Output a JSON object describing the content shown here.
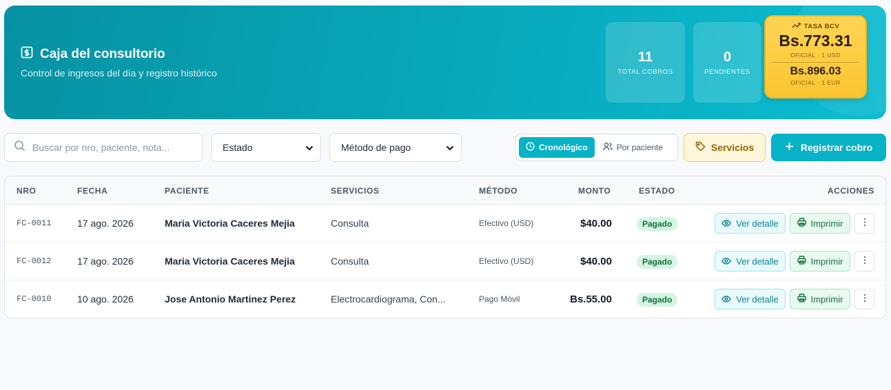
{
  "header": {
    "title": "Caja del consultorio",
    "subtitle": "Control de ingresos del día y registro histórico",
    "stats": [
      {
        "value": "11",
        "label": "TOTAL COBROS"
      },
      {
        "value": "0",
        "label": "PENDIENTES"
      }
    ],
    "rate": {
      "label": "TASA BCV",
      "usd_value": "Bs.773.31",
      "usd_note": "OFICIAL · 1 USD",
      "eur_value": "Bs.896.03",
      "eur_note": "OFICIAL · 1 EUR"
    }
  },
  "toolbar": {
    "search_placeholder": "Buscar por nro, paciente, nota...",
    "estado_select": "Estado",
    "metodo_select": "Método de pago",
    "view_chrono": "Cronológico",
    "view_patient": "Por paciente",
    "services_button": "Servicios",
    "register_button": "Registrar cobro"
  },
  "table": {
    "headers": {
      "nro": "NRO",
      "fecha": "FECHA",
      "paciente": "PACIENTE",
      "servicios": "SERVICIOS",
      "metodo": "MÉTODO",
      "monto": "MONTO",
      "estado": "ESTADO",
      "acciones": "ACCIONES"
    },
    "actions": {
      "view": "Ver detalle",
      "print": "Imprimir"
    },
    "rows": [
      {
        "nro": "FC-0011",
        "fecha": "17 ago. 2026",
        "paciente": "Maria Victoria Caceres Mejia",
        "servicios": "Consulta",
        "metodo": "Efectivo (USD)",
        "monto": "$40.00",
        "estado": "Pagado"
      },
      {
        "nro": "FC-0012",
        "fecha": "17 ago. 2026",
        "paciente": "Maria Victoria Caceres Mejia",
        "servicios": "Consulta",
        "metodo": "Efectivo (USD)",
        "monto": "$40.00",
        "estado": "Pagado"
      },
      {
        "nro": "FC-0010",
        "fecha": "10 ago. 2026",
        "paciente": "Jose Antonio Martinez Perez",
        "servicios": "Electrocardiograma, Con...",
        "metodo": "Pago Móvil",
        "monto": "Bs.55.00",
        "estado": "Pagado"
      }
    ]
  },
  "colors": {
    "accent": "#08b2c7",
    "rate_bg": "#fbc531",
    "paid_badge": "#d3f5e1"
  }
}
